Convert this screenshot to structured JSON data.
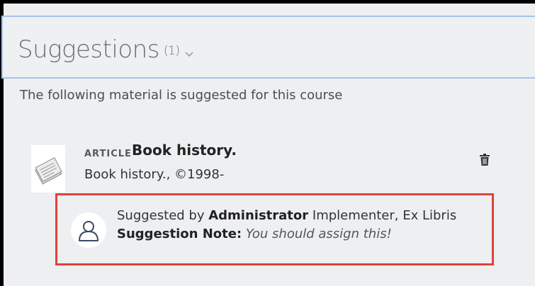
{
  "section": {
    "title": "Suggestions",
    "count": "(1)"
  },
  "description": "The following material is suggested for this course",
  "item": {
    "type": "ARTICLE",
    "title": "Book history.",
    "citation": "Book history., ©1998-",
    "icons": {
      "thumbnail": "article-paper-icon",
      "delete": "trash-icon"
    }
  },
  "suggestion": {
    "prefix": "Suggested by",
    "suggester_first": "Administrator",
    "suggester_rest": "Implementer, Ex Libris",
    "note_label": "Suggestion Note:",
    "note_text": "You should assign this!",
    "icon": "user-icon"
  },
  "colors": {
    "highlight_border": "#e0423d",
    "header_border": "#a8c4ea",
    "panel_bg": "#edeff1"
  }
}
